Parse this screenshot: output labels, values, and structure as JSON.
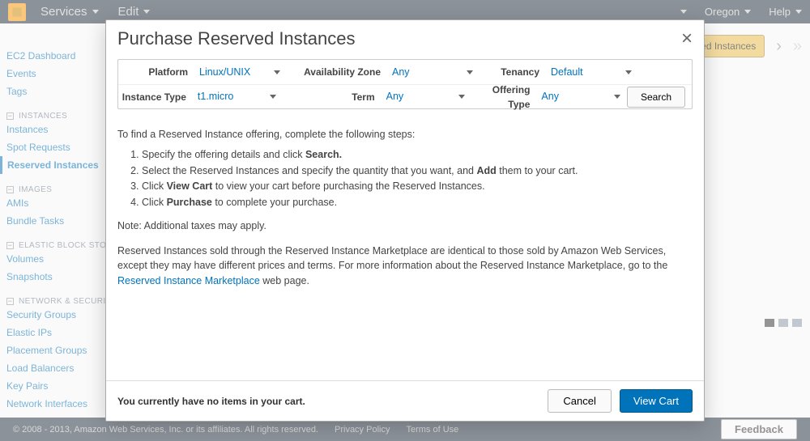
{
  "topbar": {
    "services": "Services",
    "edit": "Edit",
    "region": "Oregon",
    "help": "Help"
  },
  "sidebar": {
    "dashboard": "EC2 Dashboard",
    "events": "Events",
    "tags": "Tags",
    "sec_instances_head": "INSTANCES",
    "instances": "Instances",
    "spot": "Spot Requests",
    "reserved": "Reserved Instances",
    "sec_images_head": "IMAGES",
    "amis": "AMIs",
    "bundle": "Bundle Tasks",
    "sec_ebs_head": "ELASTIC BLOCK STORE",
    "volumes": "Volumes",
    "snapshots": "Snapshots",
    "sec_net_head": "NETWORK & SECURITY",
    "sg": "Security Groups",
    "eips": "Elastic IPs",
    "pg": "Placement Groups",
    "lb": "Load Balancers",
    "kp": "Key Pairs",
    "ni": "Network Interfaces"
  },
  "content_head": {
    "purchase_btn": "ed Instances"
  },
  "footer": {
    "copyright": "© 2008 - 2013, Amazon Web Services, Inc. or its affiliates. All rights reserved.",
    "privacy": "Privacy Policy",
    "terms": "Terms of Use",
    "feedback": "Feedback"
  },
  "modal": {
    "title": "Purchase Reserved Instances",
    "filters": {
      "platform_label": "Platform",
      "platform_val": "Linux/UNIX",
      "az_label": "Availability Zone",
      "az_val": "Any",
      "tenancy_label": "Tenancy",
      "tenancy_val": "Default",
      "itype_label": "Instance Type",
      "itype_val": "t1.micro",
      "term_label": "Term",
      "term_val": "Any",
      "otype_label": "Offering Type",
      "otype_val": "Any",
      "search": "Search"
    },
    "intro": "To find a Reserved Instance offering, complete the following steps:",
    "step1a": "Specify the offering details and click ",
    "step1b": "Search.",
    "step2a": "Select the Reserved Instances and specify the quantity that you want, and ",
    "step2b": "Add",
    "step2c": " them to your cart.",
    "step3a": "Click ",
    "step3b": "View Cart",
    "step3c": " to view your cart before purchasing the Reserved Instances.",
    "step4a": "Click ",
    "step4b": "Purchase",
    "step4c": " to complete your purchase.",
    "note": "Note: Additional taxes may apply.",
    "para_a": "Reserved Instances sold through the Reserved Instance Marketplace are identical to those sold by Amazon Web Services, except they may have different prices and terms. For more information about the Reserved Instance Marketplace, go to the ",
    "para_link": "Reserved Instance Marketplace",
    "para_b": " web page.",
    "cart_msg": "You currently have no items in your cart.",
    "cancel": "Cancel",
    "view_cart": "View Cart"
  }
}
